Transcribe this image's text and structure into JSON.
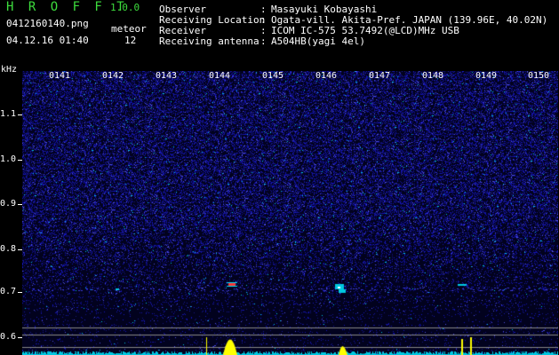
{
  "header": {
    "app_title": "H R O F F T",
    "version": "1.0.0",
    "filename": "0412160140.png",
    "datetime": "04.12.16 01:40",
    "meteor_label": "meteor",
    "meteor_count": "12"
  },
  "info": [
    {
      "label": "Observer",
      "value": "Masayuki Kobayashi"
    },
    {
      "label": "Receiving Location",
      "value": "Ogata-vill. Akita-Pref. JAPAN (139.96E, 40.02N)"
    },
    {
      "label": "Receiver",
      "value": "ICOM IC-575 53.7492(@LCD)MHz USB"
    },
    {
      "label": "Receiving antenna",
      "value": "A504HB(yagi 4el)"
    }
  ],
  "axis": {
    "unit": "kHz",
    "y_ticks": [
      "1.1",
      "1.0",
      "0.9",
      "0.8",
      "0.7",
      "0.6"
    ],
    "x_ticks": [
      "0141",
      "0142",
      "0143",
      "0144",
      "0145",
      "0146",
      "0147",
      "0148",
      "0149",
      "0150"
    ]
  },
  "colors": {
    "header_accent": "#3ddc3d",
    "background": "#000000",
    "noise": "#1a1aa0",
    "signal": "#ffff00",
    "baseline": "#00c8e0"
  }
}
